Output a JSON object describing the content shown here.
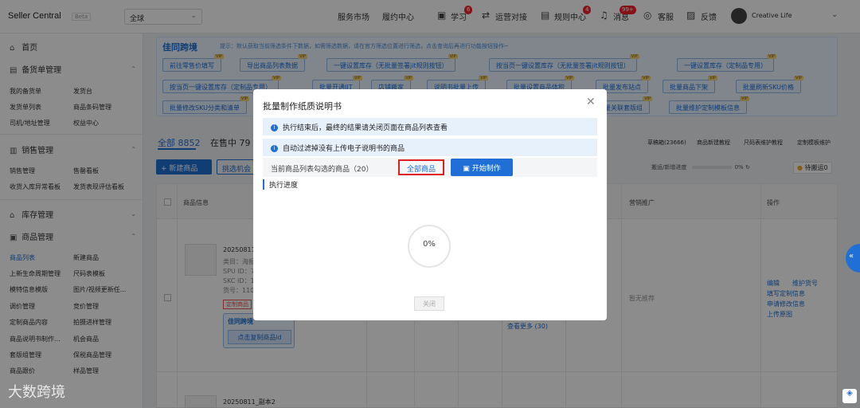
{
  "topbar": {
    "brand": "Seller Central",
    "beta": "Beta",
    "region": "全球",
    "nav": [
      "服务市场",
      "履约中心"
    ],
    "items": [
      {
        "label": "学习",
        "badge": "6"
      },
      {
        "label": "运营对接",
        "badge": ""
      },
      {
        "label": "规则中心",
        "badge": "4"
      },
      {
        "label": "消息",
        "badge": "99+"
      },
      {
        "label": "客服",
        "badge": ""
      },
      {
        "label": "反馈",
        "badge": ""
      }
    ],
    "user": "Creative Life"
  },
  "sidebar": {
    "home": "首页",
    "groups": [
      {
        "title": "备货单管理",
        "items": [
          "我的备货单",
          "发货台",
          "发货单列表",
          "商品条码管理",
          "司机/地址管理",
          "权益中心"
        ]
      },
      {
        "title": "销售管理",
        "items": [
          "销售管理",
          "售罄看板",
          "收货入库异常看板",
          "发货表现评估看板"
        ]
      },
      {
        "title": "库存管理",
        "items": []
      },
      {
        "title": "商品管理",
        "items": [
          "商品列表",
          "新建商品",
          "上新生命周期管理",
          "尺码表模板",
          "模特信息模版",
          "图片/视频更新任...",
          "调价管理",
          "竞价管理",
          "定制商品内容",
          "拍摄进样管理",
          "商品说明书制作...",
          "机会商品",
          "套版组管理",
          "保税商品管理",
          "商品跟价",
          "样品管理"
        ]
      }
    ]
  },
  "banner": {
    "logo": "佳同跨境",
    "tip": "提示：默认获取当前筛选条件下数据，如需筛选数据，请在官方筛选位置进行筛选，点击查询后再进行功能按钮操作~",
    "row1": [
      "前往零售价填写",
      "导出商品列表数据",
      "一键设置库存（无批量签署jit规则按钮）",
      "按当页一键设置库存（无批量签署jit规则按钮）",
      "一键设置库存（定制品专用）"
    ],
    "row2": [
      "按当页一键设置库存（定制品专用）",
      "批量开通JIT",
      "店铺搬家",
      "说明书批量上传",
      "批量设置商品体积",
      "批量发布站点",
      "批量商品下架",
      "批量刷新SKU价格"
    ],
    "row3": [
      "批量修改SKU分类和清单",
      "批量关联套版组",
      "批量维护定制模板信息"
    ],
    "vip": "VIP"
  },
  "tabs": {
    "all": "全部 8852",
    "onsale": "在售中 79"
  },
  "right_links": [
    "草稿箱(23666)",
    "商品新建教程",
    "尺码表维护教程",
    "定制模板维护"
  ],
  "toolbar": {
    "new": "+ 新建商品",
    "pick": "挑选机会",
    "progress": "搬运/新增进度",
    "progress_pct": "0%",
    "pending": "待搬运0"
  },
  "table": {
    "headers": [
      "商品信息",
      "营销推广",
      "操作"
    ],
    "rows": [
      {
        "name": "20250811",
        "category": "类目：海报",
        "spu": "SPU ID：7",
        "skc": "SKC ID：1",
        "sku": "货号：110",
        "tag": "定制商品",
        "copy_btn": "点击复制商品id",
        "brand": "佳同跨境",
        "more": "查看更多 (30)",
        "promo": "暂无推荐",
        "ops": [
          "编辑",
          "维护货号",
          "填写定制信息",
          "申请修改信息",
          "上传原图"
        ]
      },
      {
        "name": "20250811_副本2"
      }
    ]
  },
  "modal": {
    "title": "批量制作纸质说明书",
    "note1": "执行结束后，最终的结果请关闭页面在商品列表查看",
    "note2": "自动过滤掉没有上传电子说明书的商品",
    "selected": "当前商品列表勾选的商品（20）",
    "all_goods": "全部商品",
    "start": "开始制作",
    "exec": "执行进度",
    "progress": "0%",
    "close": "关闭"
  },
  "watermark": "大数跨境",
  "colors": {
    "primary": "#1f6fd6",
    "highlight": "#e02020",
    "badge": "#f5222d"
  }
}
